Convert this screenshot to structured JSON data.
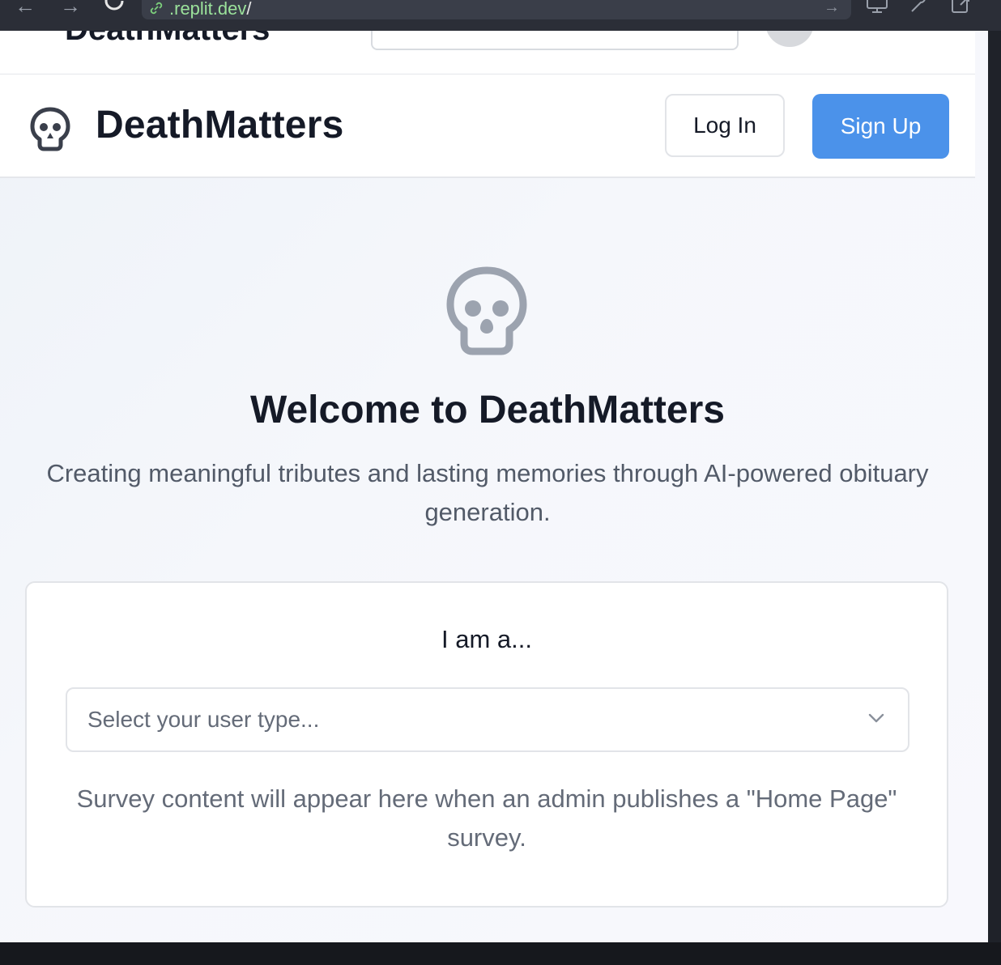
{
  "browser": {
    "url_domain": ".replit.dev",
    "url_path": "/"
  },
  "ghost_header": {
    "title": "DeathMatters"
  },
  "header": {
    "brand": "DeathMatters",
    "login_label": "Log In",
    "signup_label": "Sign Up"
  },
  "hero": {
    "title": "Welcome to DeathMatters",
    "subtitle": "Creating meaningful tributes and lasting memories through AI-powered obituary generation."
  },
  "survey": {
    "label": "I am a...",
    "select_placeholder": "Select your user type...",
    "note": "Survey content will appear here when an admin publishes a \"Home Page\" survey."
  },
  "colors": {
    "accent": "#4b92ea",
    "text_dark": "#151a27",
    "text_muted": "#646b78",
    "icon_gray": "#9ca3af"
  },
  "icons": {
    "logo": "skull-icon",
    "hero": "skull-icon",
    "select": "chevron-down-icon"
  }
}
